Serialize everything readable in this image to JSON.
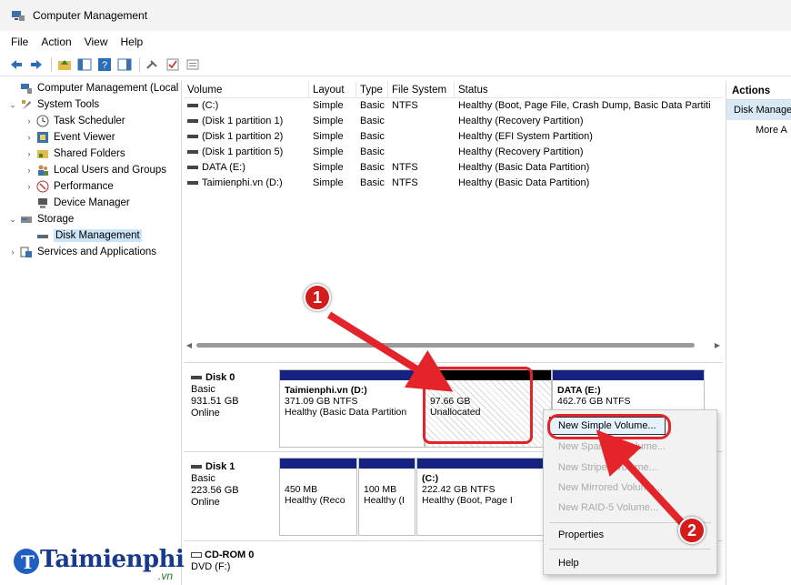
{
  "window": {
    "title": "Computer Management"
  },
  "menu": [
    "File",
    "Action",
    "View",
    "Help"
  ],
  "tree": {
    "items": [
      {
        "label": "Computer Management (Local",
        "expander": "",
        "icon": "computer-management-icon",
        "level": 0
      },
      {
        "label": "System Tools",
        "expander": "⌄",
        "icon": "system-tools-icon",
        "level": 1
      },
      {
        "label": "Task Scheduler",
        "expander": "›",
        "icon": "clock-icon",
        "level": 2
      },
      {
        "label": "Event Viewer",
        "expander": "›",
        "icon": "event-viewer-icon",
        "level": 2
      },
      {
        "label": "Shared Folders",
        "expander": "›",
        "icon": "shared-folder-icon",
        "level": 2
      },
      {
        "label": "Local Users and Groups",
        "expander": "›",
        "icon": "users-icon",
        "level": 2
      },
      {
        "label": "Performance",
        "expander": "›",
        "icon": "performance-icon",
        "level": 2
      },
      {
        "label": "Device Manager",
        "expander": "",
        "icon": "device-manager-icon",
        "level": 2
      },
      {
        "label": "Storage",
        "expander": "⌄",
        "icon": "storage-icon",
        "level": 1
      },
      {
        "label": "Disk Management",
        "expander": "",
        "icon": "disk-management-icon",
        "level": 2,
        "selected": true
      },
      {
        "label": "Services and Applications",
        "expander": "›",
        "icon": "services-icon",
        "level": 1
      }
    ]
  },
  "volumes": {
    "columns": [
      "Volume",
      "Layout",
      "Type",
      "File System",
      "Status"
    ],
    "rows": [
      [
        "(C:)",
        "Simple",
        "Basic",
        "NTFS",
        "Healthy (Boot, Page File, Crash Dump, Basic Data Partiti"
      ],
      [
        "(Disk 1 partition 1)",
        "Simple",
        "Basic",
        "",
        "Healthy (Recovery Partition)"
      ],
      [
        "(Disk 1 partition 2)",
        "Simple",
        "Basic",
        "",
        "Healthy (EFI System Partition)"
      ],
      [
        "(Disk 1 partition 5)",
        "Simple",
        "Basic",
        "",
        "Healthy (Recovery Partition)"
      ],
      [
        "DATA (E:)",
        "Simple",
        "Basic",
        "NTFS",
        "Healthy (Basic Data Partition)"
      ],
      [
        "Taimienphi.vn (D:)",
        "Simple",
        "Basic",
        "NTFS",
        "Healthy (Basic Data Partition)"
      ]
    ]
  },
  "disks": {
    "disk0": {
      "name": "Disk 0",
      "type": "Basic",
      "size": "931.51 GB",
      "status": "Online",
      "p1": {
        "name": "Taimienphi.vn  (D:)",
        "size": "371.09 GB NTFS",
        "status": "Healthy (Basic Data Partition"
      },
      "p2": {
        "size": "97.66 GB",
        "status": "Unallocated"
      },
      "p3": {
        "name": "DATA  (E:)",
        "size": "462.76 GB NTFS"
      }
    },
    "disk1": {
      "name": "Disk 1",
      "type": "Basic",
      "size": "223.56 GB",
      "status": "Online",
      "p1": {
        "size": "450 MB",
        "status": "Healthy (Reco"
      },
      "p2": {
        "size": "100 MB",
        "status": "Healthy (I"
      },
      "p3": {
        "name": "(C:)",
        "size": "222.42 GB NTFS",
        "status": "Healthy (Boot, Page I"
      }
    },
    "cdrom": {
      "name": "CD-ROM 0",
      "drive": "DVD (F:)"
    }
  },
  "actions": {
    "header": "Actions",
    "selected": "Disk Manage",
    "more": "More A"
  },
  "context_menu": {
    "items": [
      {
        "label": "New Simple Volume...",
        "disabled": false
      },
      {
        "label": "New Spanned Volume...",
        "disabled": true
      },
      {
        "label": "New Striped Volume...",
        "disabled": true
      },
      {
        "label": "New Mirrored Volume...",
        "disabled": true
      },
      {
        "label": "New RAID-5 Volume...",
        "disabled": true
      },
      {
        "label": "Properties",
        "disabled": false
      },
      {
        "label": "Help",
        "disabled": false
      }
    ]
  },
  "annotations": {
    "marker1": "1",
    "marker2": "2",
    "color": "#e4232a"
  },
  "watermark": {
    "brand": "Taimienphi",
    "domain": ".vn"
  }
}
